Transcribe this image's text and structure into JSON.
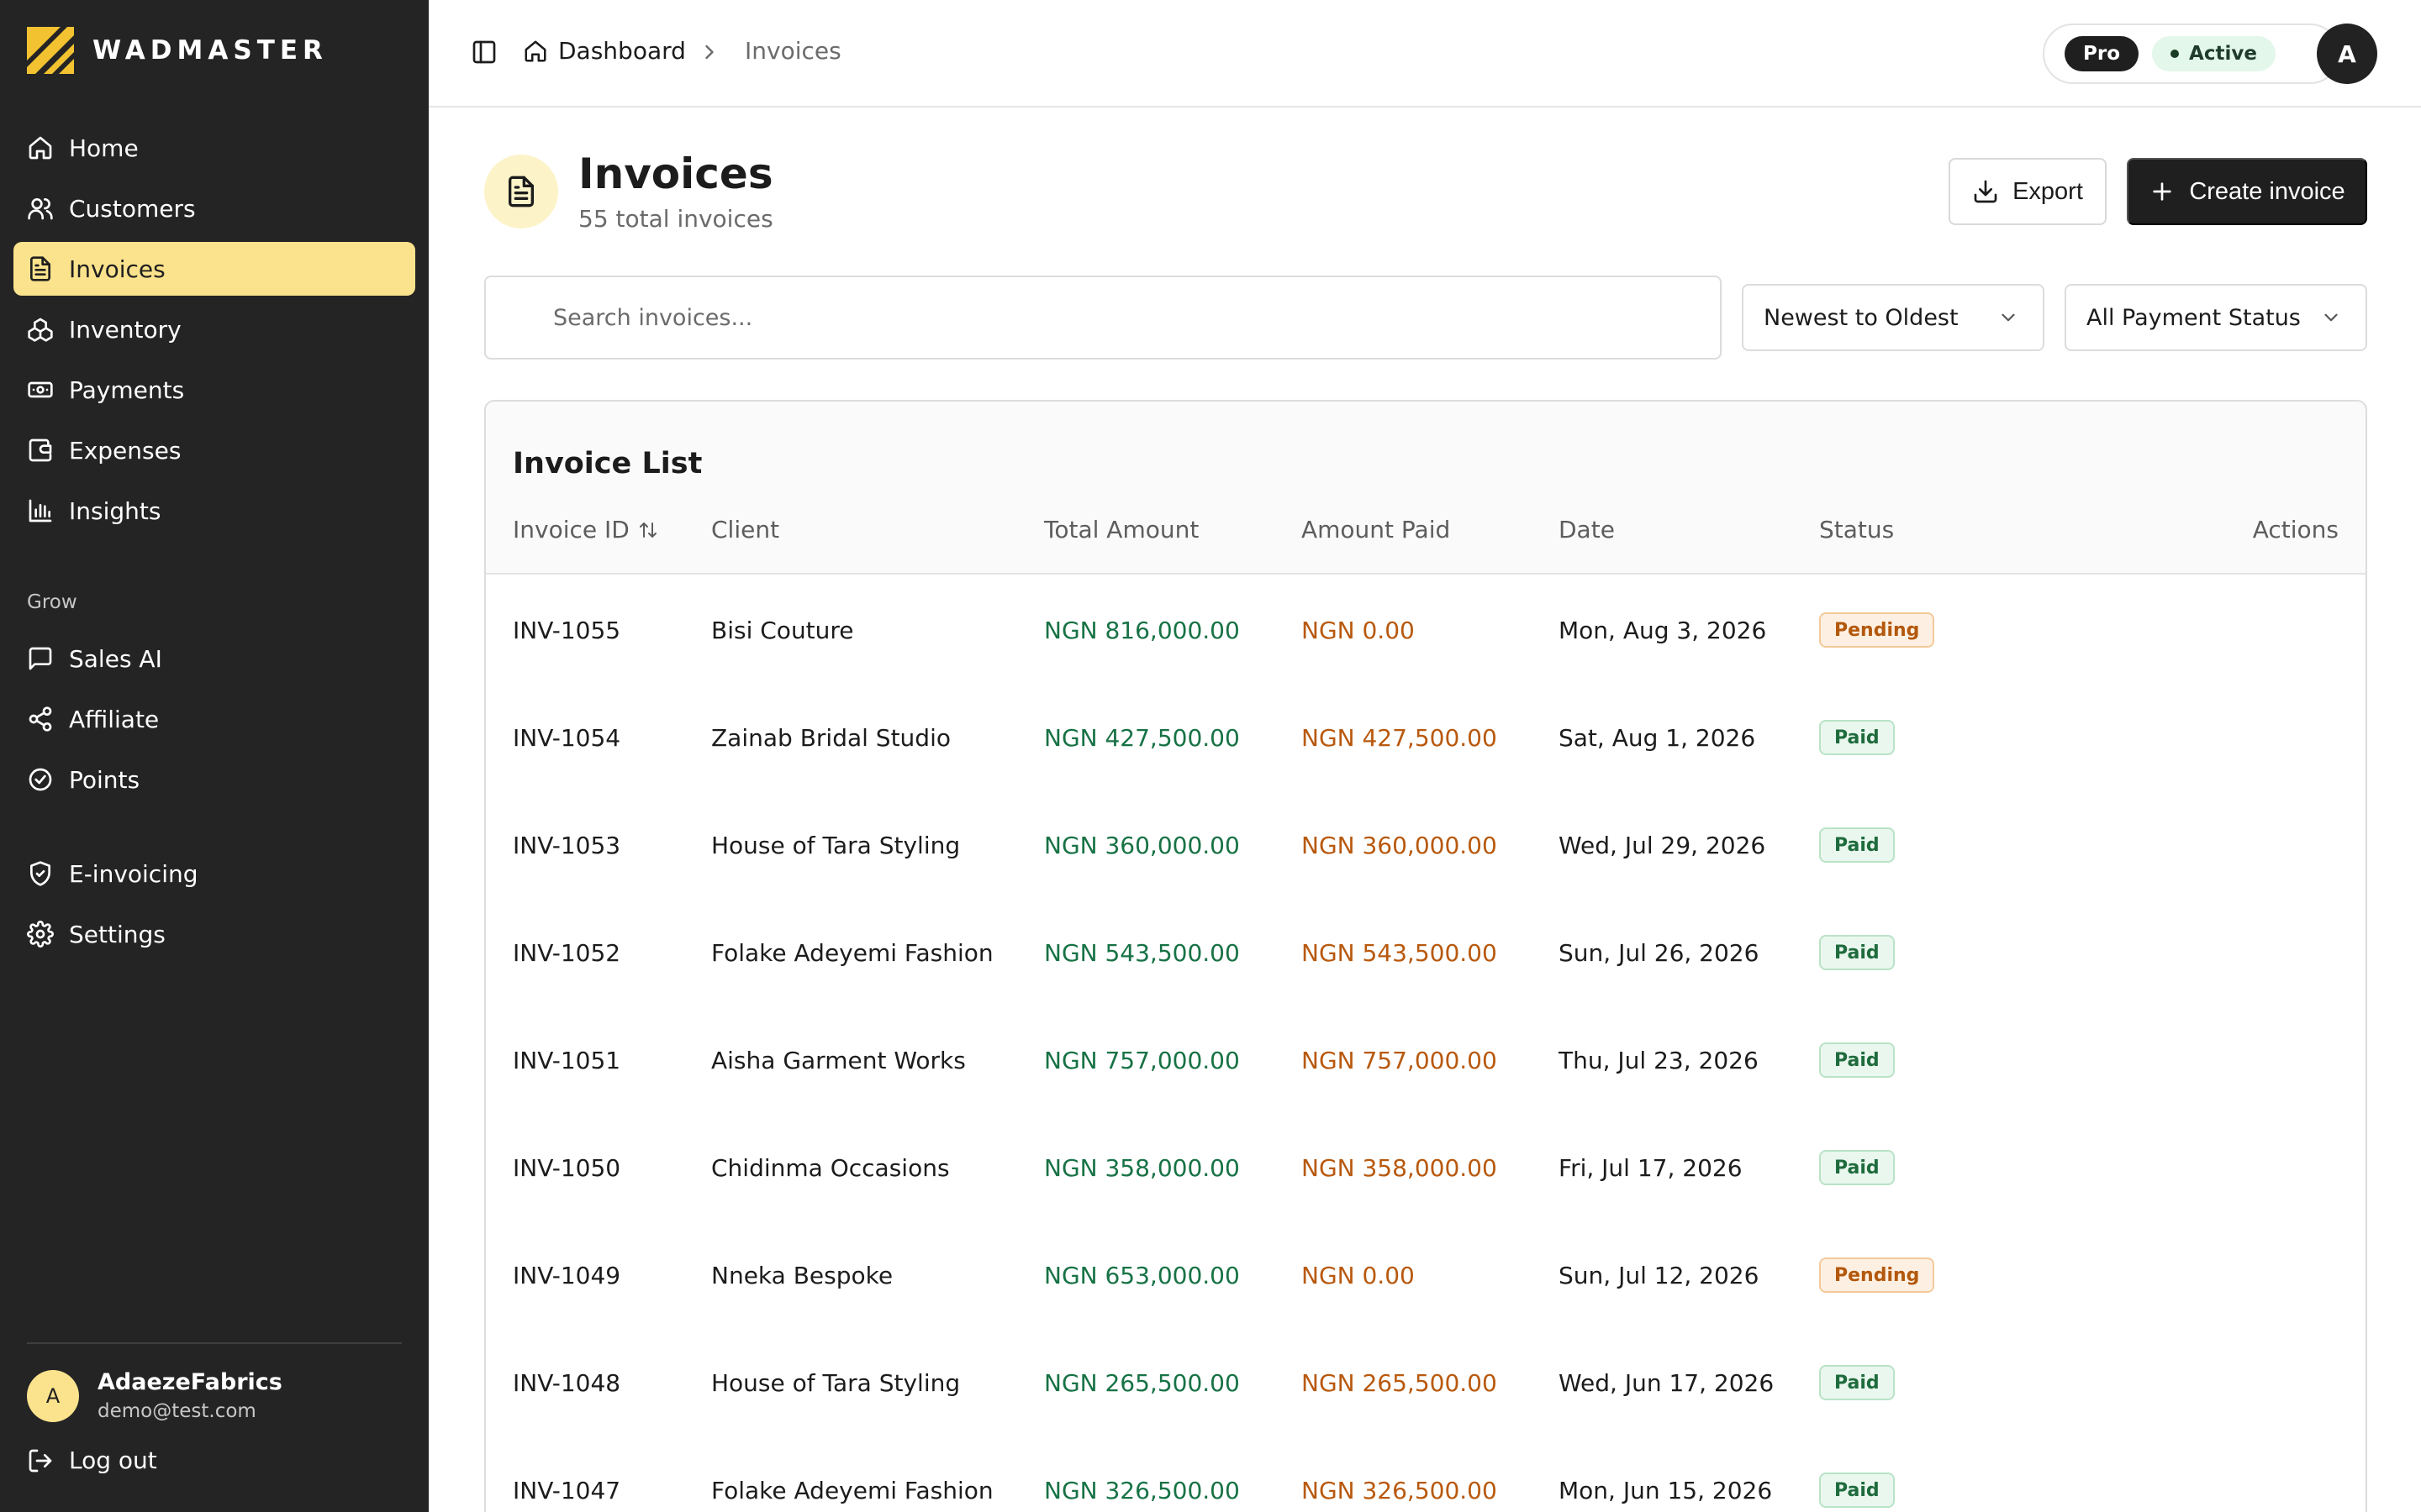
{
  "brand": {
    "name": "WADMASTER"
  },
  "sidebar": {
    "items": [
      {
        "label": "Home",
        "icon": "home-icon"
      },
      {
        "label": "Customers",
        "icon": "users-icon"
      },
      {
        "label": "Invoices",
        "icon": "file-text-icon",
        "active": true
      },
      {
        "label": "Inventory",
        "icon": "boxes-icon"
      },
      {
        "label": "Payments",
        "icon": "banknote-icon"
      },
      {
        "label": "Expenses",
        "icon": "wallet-icon"
      },
      {
        "label": "Insights",
        "icon": "bar-chart-icon"
      }
    ],
    "grow_heading": "Grow",
    "grow_items": [
      {
        "label": "Sales AI",
        "icon": "message-square-icon"
      },
      {
        "label": "Affiliate",
        "icon": "share-icon"
      },
      {
        "label": "Points",
        "icon": "badge-check-icon"
      }
    ],
    "bottom_items": [
      {
        "label": "E-invoicing",
        "icon": "shield-check-icon"
      },
      {
        "label": "Settings",
        "icon": "gear-icon"
      }
    ],
    "user": {
      "initial": "A",
      "name": "AdaezeFabrics",
      "email": "demo@test.com"
    },
    "logout_label": "Log out"
  },
  "topbar": {
    "breadcrumb": {
      "home": "Dashboard",
      "current": "Invoices"
    },
    "plan": "Pro",
    "plan_status": "Active",
    "avatar_initial": "A"
  },
  "page": {
    "title": "Invoices",
    "subtitle": "55 total invoices",
    "export_label": "Export",
    "create_label": "Create invoice"
  },
  "filters": {
    "search_placeholder": "Search invoices...",
    "sort_value": "Newest to Oldest",
    "status_value": "All Payment Status"
  },
  "table": {
    "title": "Invoice List",
    "columns": {
      "id": "Invoice ID",
      "client": "Client",
      "total": "Total Amount",
      "paid": "Amount Paid",
      "date": "Date",
      "status": "Status",
      "actions": "Actions"
    },
    "rows": [
      {
        "id": "INV-1055",
        "client": "Bisi Couture",
        "total": "NGN 816,000.00",
        "paid": "NGN 0.00",
        "date": "Mon, Aug 3, 2026",
        "status": "Pending"
      },
      {
        "id": "INV-1054",
        "client": "Zainab Bridal Studio",
        "total": "NGN 427,500.00",
        "paid": "NGN 427,500.00",
        "date": "Sat, Aug 1, 2026",
        "status": "Paid"
      },
      {
        "id": "INV-1053",
        "client": "House of Tara Styling",
        "total": "NGN 360,000.00",
        "paid": "NGN 360,000.00",
        "date": "Wed, Jul 29, 2026",
        "status": "Paid"
      },
      {
        "id": "INV-1052",
        "client": "Folake Adeyemi Fashion",
        "total": "NGN 543,500.00",
        "paid": "NGN 543,500.00",
        "date": "Sun, Jul 26, 2026",
        "status": "Paid"
      },
      {
        "id": "INV-1051",
        "client": "Aisha Garment Works",
        "total": "NGN 757,000.00",
        "paid": "NGN 757,000.00",
        "date": "Thu, Jul 23, 2026",
        "status": "Paid"
      },
      {
        "id": "INV-1050",
        "client": "Chidinma Occasions",
        "total": "NGN 358,000.00",
        "paid": "NGN 358,000.00",
        "date": "Fri, Jul 17, 2026",
        "status": "Paid"
      },
      {
        "id": "INV-1049",
        "client": "Nneka Bespoke",
        "total": "NGN 653,000.00",
        "paid": "NGN 0.00",
        "date": "Sun, Jul 12, 2026",
        "status": "Pending"
      },
      {
        "id": "INV-1048",
        "client": "House of Tara Styling",
        "total": "NGN 265,500.00",
        "paid": "NGN 265,500.00",
        "date": "Wed, Jun 17, 2026",
        "status": "Paid"
      },
      {
        "id": "INV-1047",
        "client": "Folake Adeyemi Fashion",
        "total": "NGN 326,500.00",
        "paid": "NGN 326,500.00",
        "date": "Mon, Jun 15, 2026",
        "status": "Paid"
      }
    ]
  },
  "colors": {
    "sidebar_bg": "#242424",
    "accent_yellow": "#fbe38d",
    "amount_green": "#177245",
    "amount_orange": "#b8590e"
  }
}
